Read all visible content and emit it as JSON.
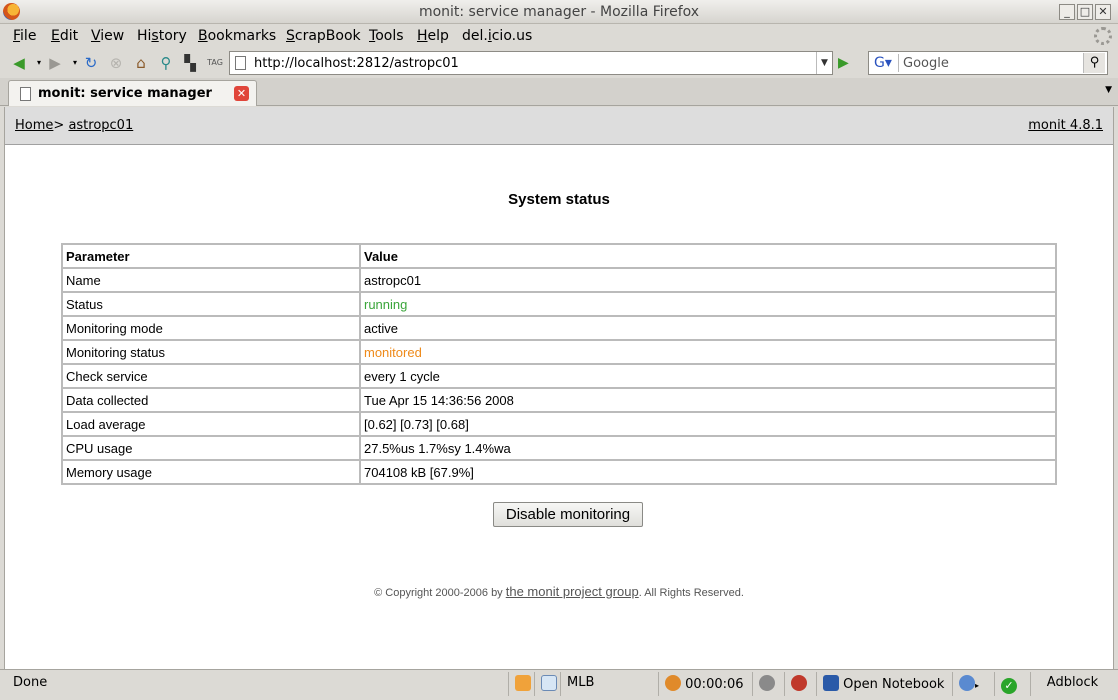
{
  "window": {
    "title": "monit: service manager - Mozilla Firefox"
  },
  "menu": {
    "items": [
      {
        "pre": "",
        "u": "F",
        "post": "ile"
      },
      {
        "pre": "",
        "u": "E",
        "post": "dit"
      },
      {
        "pre": "",
        "u": "V",
        "post": "iew"
      },
      {
        "pre": "Hi",
        "u": "s",
        "post": "tory"
      },
      {
        "pre": "",
        "u": "B",
        "post": "ookmarks"
      },
      {
        "pre": "",
        "u": "S",
        "post": "crapBook"
      },
      {
        "pre": "",
        "u": "T",
        "post": "ools"
      },
      {
        "pre": "",
        "u": "H",
        "post": "elp"
      },
      {
        "pre": "del.",
        "u": "i",
        "post": "cio.us"
      }
    ]
  },
  "navbar": {
    "url": "http://localhost:2812/astropc01",
    "search_placeholder": "Google"
  },
  "tab": {
    "label": "monit: service manager"
  },
  "page": {
    "breadcrumb_home": "Home",
    "breadcrumb_sep": ">",
    "breadcrumb_current": "astropc01",
    "version": "monit 4.8.1",
    "heading": "System status",
    "table": {
      "headers": [
        "Parameter",
        "Value"
      ],
      "rows": [
        {
          "param": "Name",
          "value": "astropc01"
        },
        {
          "param": "Status",
          "value": "running"
        },
        {
          "param": "Monitoring mode",
          "value": "active"
        },
        {
          "param": "Monitoring status",
          "value": "monitored"
        },
        {
          "param": "Check service",
          "value": "every 1 cycle"
        },
        {
          "param": "Data collected",
          "value": "Tue Apr 15 14:36:56 2008"
        },
        {
          "param": "Load average",
          "value": "[0.62] [0.73] [0.68]"
        },
        {
          "param": "CPU usage",
          "value": "27.5%us 1.7%sy 1.4%wa"
        },
        {
          "param": "Memory usage",
          "value": "704108 kB [67.9%]"
        }
      ]
    },
    "disable_button": "Disable monitoring",
    "footer_prefix": "© Copyright 2000-2006 by ",
    "footer_link": "the monit project group",
    "footer_suffix": ". All Rights Reserved."
  },
  "statusbar": {
    "status": "Done",
    "mlb": "MLB",
    "timer": "00:00:06",
    "notebook": "Open Notebook",
    "adblock": "Adblock"
  },
  "colors": {
    "running": "#3aa53a",
    "monitored": "#ee8a1a"
  }
}
